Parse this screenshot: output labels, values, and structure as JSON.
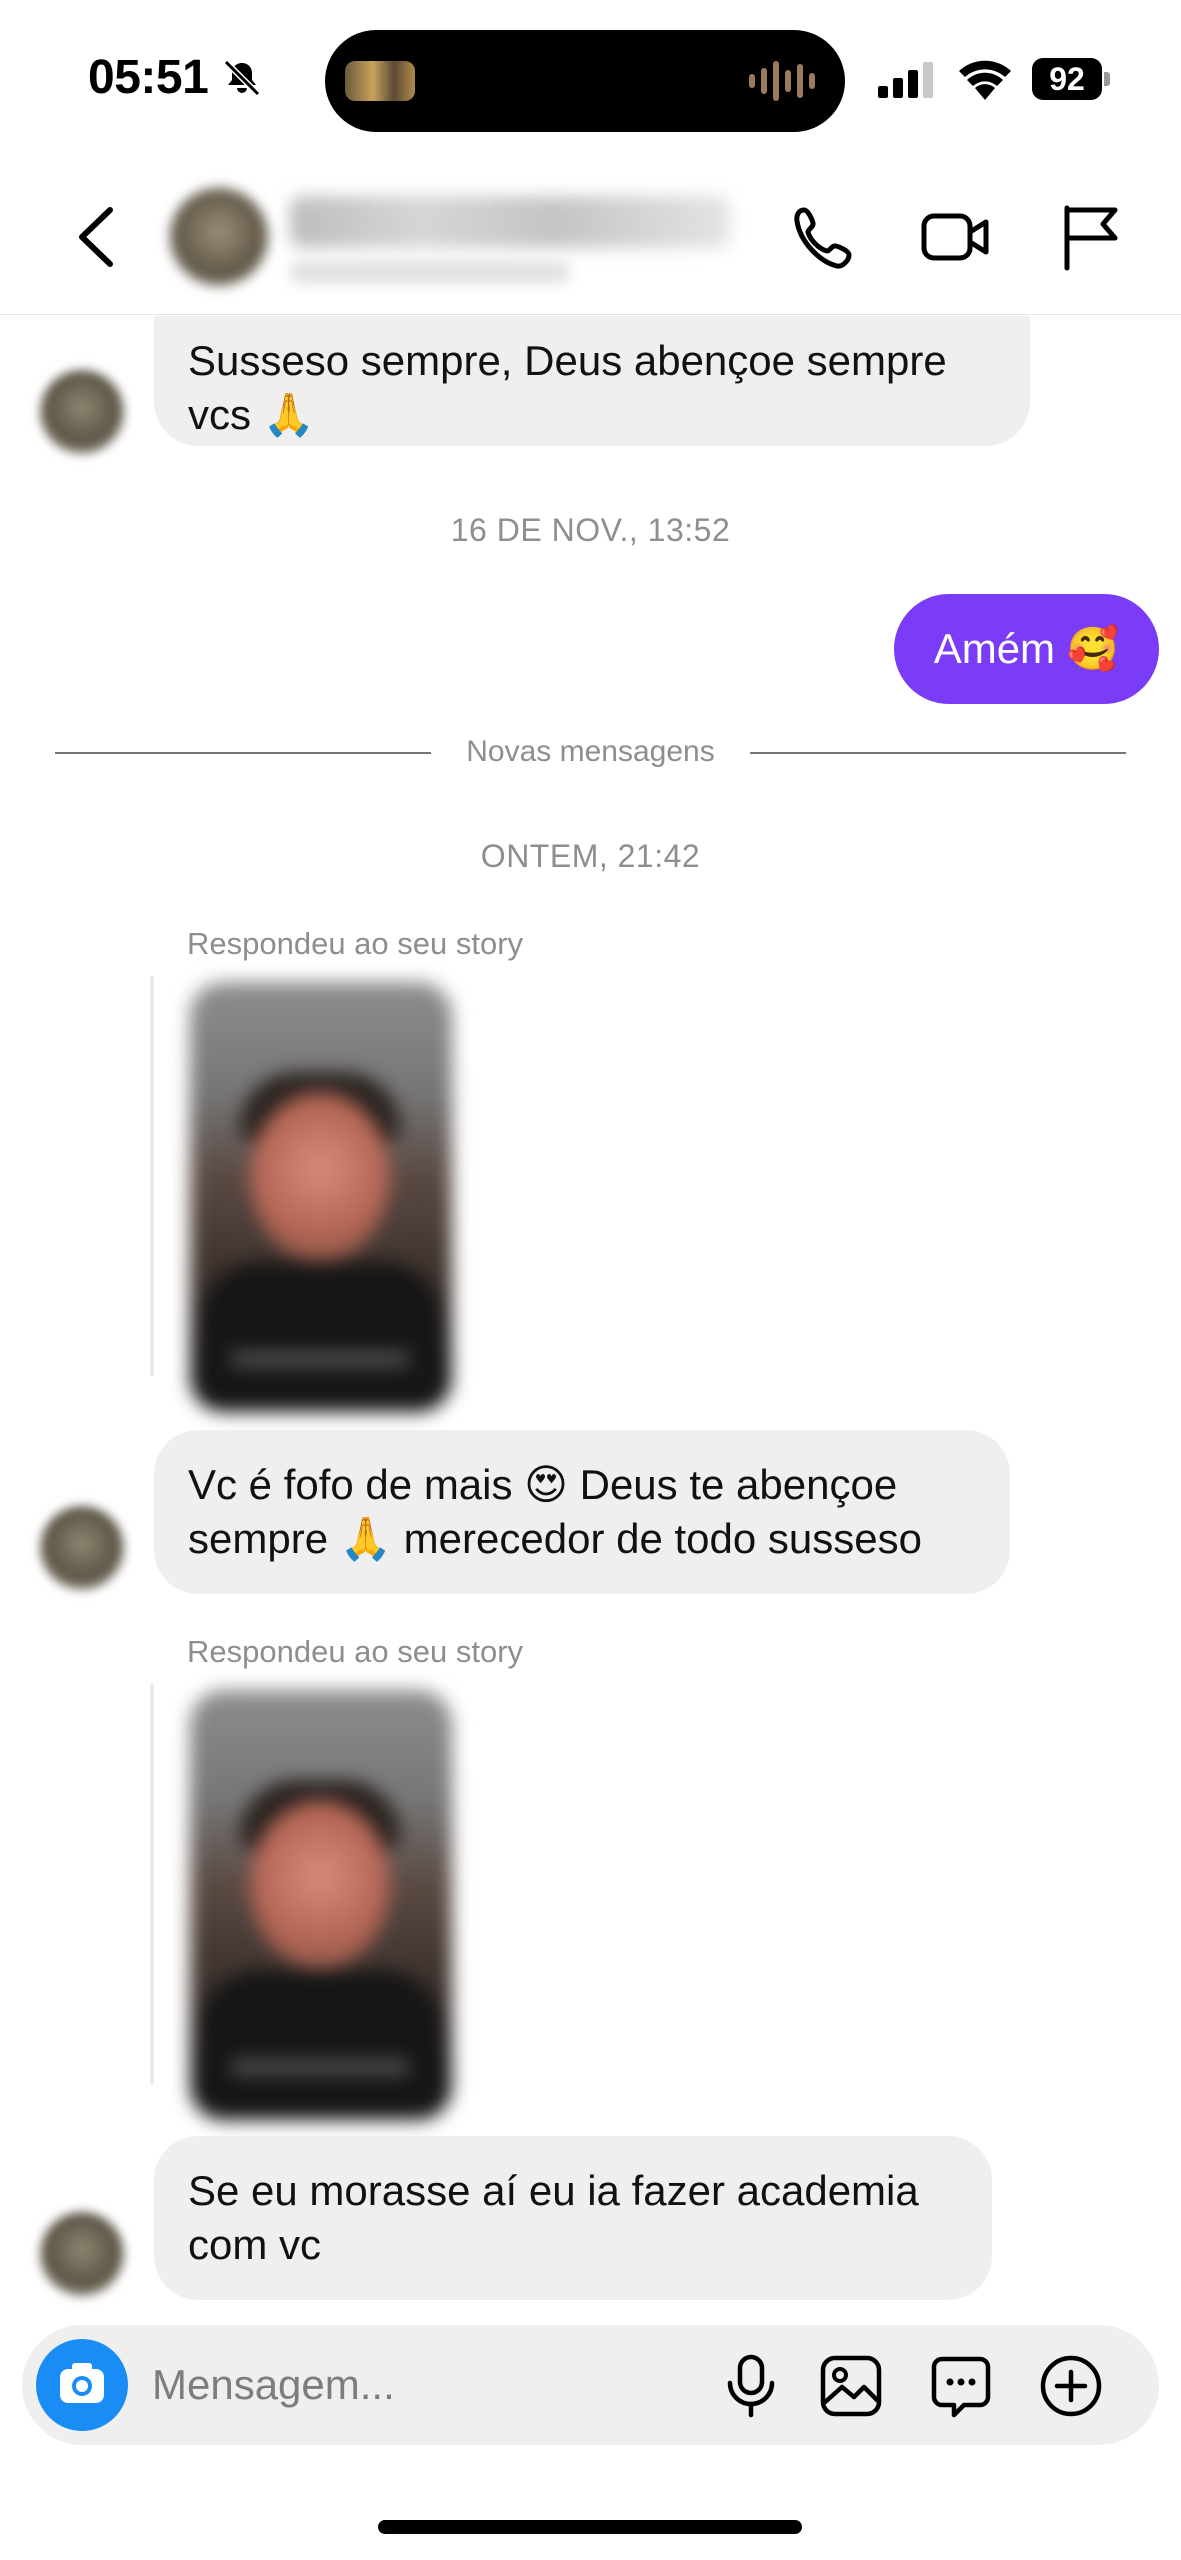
{
  "status_bar": {
    "time": "05:51",
    "battery": "92"
  },
  "messages": {
    "msg1": {
      "line1": "Susseso sempre, Deus abençoe sempre",
      "line2": "vcs 🙏"
    },
    "timestamp1": "16 DE NOV., 13:52",
    "sent1": "Amém 🥰",
    "new_messages_divider": "Novas mensagens",
    "timestamp2": "ONTEM, 21:42",
    "story_reply_label_1": "Respondeu ao seu story",
    "msg2": {
      "line1": "Vc é fofo de mais 😍 Deus te abençoe",
      "line2": "sempre 🙏 merecedor de todo susseso"
    },
    "story_reply_label_2": "Respondeu ao seu story",
    "msg3": {
      "line1": "Se eu morasse aí eu ia fazer academia",
      "line2": "com vc"
    }
  },
  "composer": {
    "placeholder": "Mensagem..."
  },
  "colors": {
    "sent_bubble": "#7a3cf6",
    "received_bubble": "#efefef",
    "camera_button": "#1a8cf5"
  }
}
